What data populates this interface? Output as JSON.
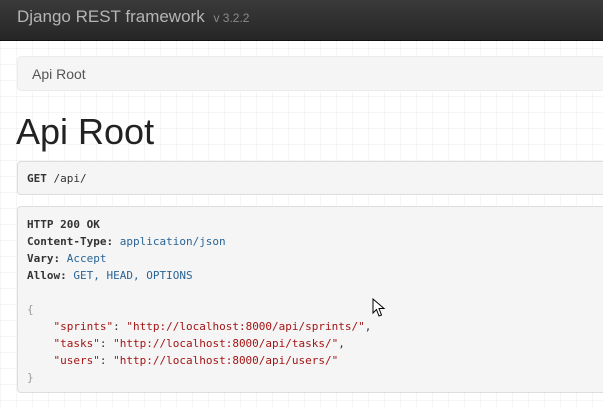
{
  "navbar": {
    "brand": "Django REST framework",
    "version": "v 3.2.2"
  },
  "breadcrumb": {
    "items": [
      "Api Root"
    ]
  },
  "page": {
    "title": "Api Root"
  },
  "request": {
    "method": "GET",
    "path": "/api/"
  },
  "response": {
    "status": "HTTP 200 OK",
    "headers": [
      {
        "key": "Content-Type:",
        "value": "application/json"
      },
      {
        "key": "Vary:",
        "value": "Accept"
      },
      {
        "key": "Allow:",
        "value": "GET, HEAD, OPTIONS"
      }
    ],
    "body": {
      "open": "{",
      "close": "}",
      "entries": [
        {
          "key": "\"sprints\"",
          "value": "\"http://localhost:8000/api/sprints/\"",
          "sep": ","
        },
        {
          "key": "\"tasks\"",
          "value": "\"http://localhost:8000/api/tasks/\"",
          "sep": ","
        },
        {
          "key": "\"users\"",
          "value": "\"http://localhost:8000/api/users/\"",
          "sep": ""
        }
      ]
    }
  },
  "colors": {
    "navbar_bg": "#2f2f2f",
    "brand_text": "#b5b5b5",
    "json_string": "#a31515",
    "header_value": "#2a6496"
  },
  "icons": {
    "cursor": "mouse-pointer-icon"
  }
}
